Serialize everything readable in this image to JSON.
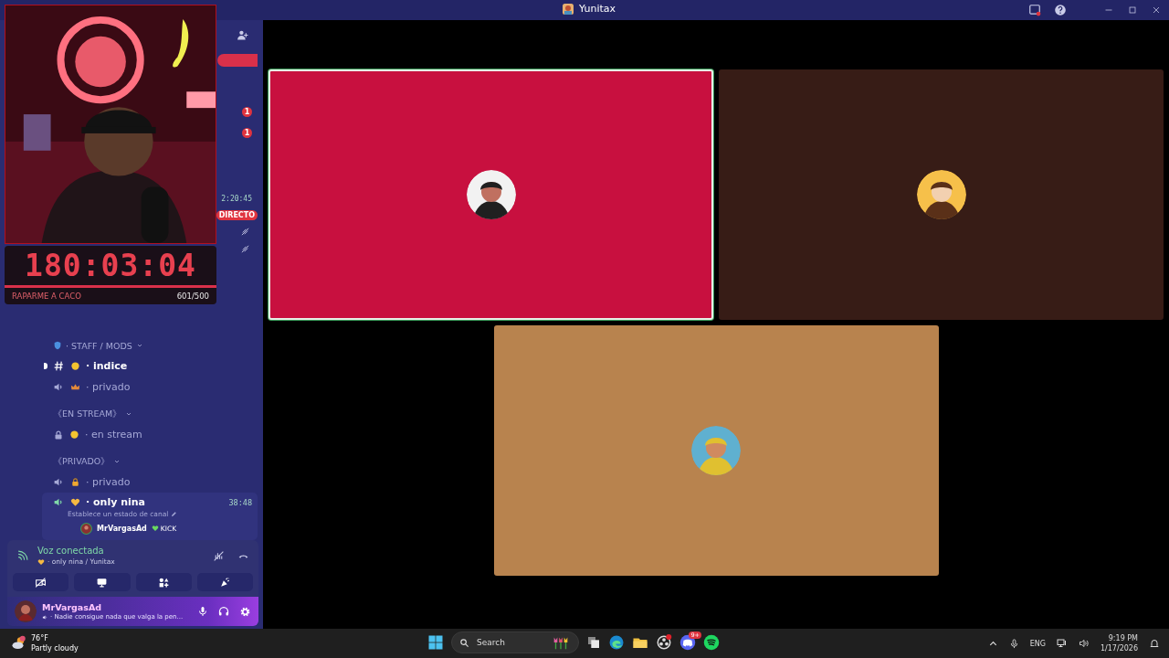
{
  "title_bar": {
    "title": "Yunitax"
  },
  "stream_overlay": {
    "timer": "180:03:04",
    "goal_label": "RAPARME A CACO",
    "goal_count": "601/500"
  },
  "sidebar_peek": {
    "badges": [
      "1",
      "1"
    ],
    "live_time": "2:20:45",
    "live_label": "DIRECTO"
  },
  "channels": [
    {
      "kind": "category",
      "name": "· STAFF / MODS"
    },
    {
      "kind": "text",
      "name": "· indice",
      "unread": true
    },
    {
      "kind": "voice",
      "name": "· privado",
      "unread": false
    },
    {
      "kind": "category",
      "name": "《EN STREAM》"
    },
    {
      "kind": "locked",
      "name": "· en stream",
      "unread": false
    },
    {
      "kind": "category",
      "name": "《PRIVADO》"
    },
    {
      "kind": "voice",
      "name": "· privado",
      "unread": false
    },
    {
      "kind": "voice_active",
      "name": "· only nina",
      "time": "38:48",
      "status": "Establece un estado de canal",
      "members": [
        {
          "name": "MrVargasAd",
          "tag": "KICK"
        }
      ]
    }
  ],
  "voice_panel": {
    "status": "Voz conectada",
    "channel": "· only nina / Yunitax"
  },
  "user_panel": {
    "name": "MrVargasAd",
    "status": "· Nadie consigue nada que valga la pen..."
  },
  "tiles": [
    {
      "color": "#c8103f",
      "speaking": true
    },
    {
      "color": "#371c16",
      "speaking": false
    },
    {
      "color": "#b8834e",
      "speaking": false
    }
  ],
  "taskbar": {
    "temperature": "76°F",
    "weather": "Partly cloudy",
    "search": "Search",
    "discord_badge": "9+",
    "language": "ENG",
    "time": "9:19 PM",
    "date": "1/17/2026"
  }
}
